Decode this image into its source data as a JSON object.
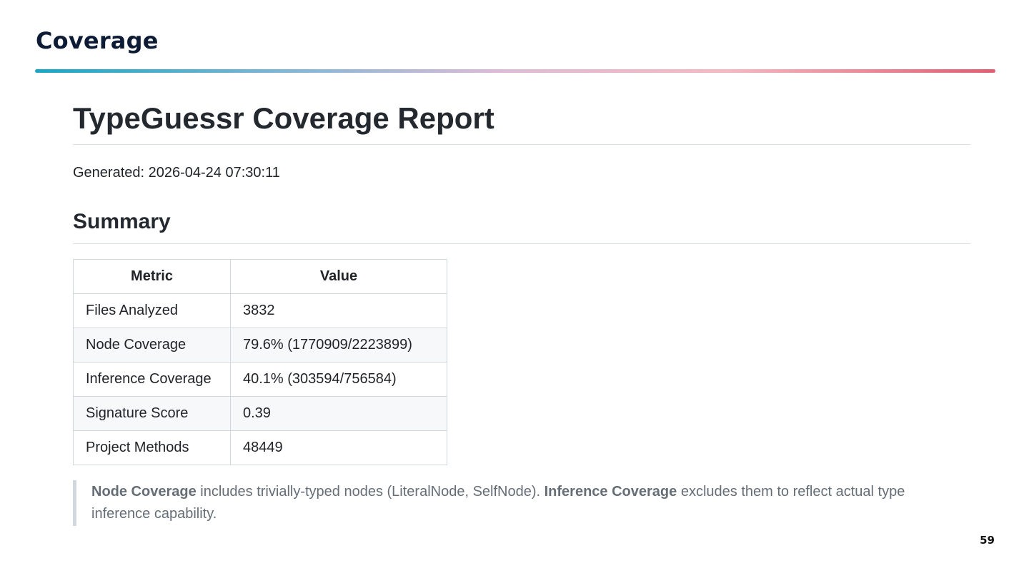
{
  "slide": {
    "title": "Coverage",
    "page_number": "59"
  },
  "report": {
    "title": "TypeGuessr Coverage Report",
    "generated": "Generated: 2026-04-24 07:30:11",
    "summary_heading": "Summary",
    "table": {
      "headers": [
        "Metric",
        "Value"
      ],
      "rows": [
        {
          "metric": "Files Analyzed",
          "value": "3832"
        },
        {
          "metric": "Node Coverage",
          "value": "79.6% (1770909/2223899)"
        },
        {
          "metric": "Inference Coverage",
          "value": "40.1% (303594/756584)"
        },
        {
          "metric": "Signature Score",
          "value": "0.39"
        },
        {
          "metric": "Project Methods",
          "value": "48449"
        }
      ]
    },
    "note": {
      "term1": "Node Coverage",
      "text1": " includes trivially-typed nodes (LiteralNode, SelfNode). ",
      "term2": "Inference Coverage",
      "text2": " excludes them to reflect actual type inference capability."
    }
  },
  "colors": {
    "title": "#0d1b35",
    "rule_start": "#17a7c4",
    "rule_end": "#e25d72",
    "note_text": "#656d76"
  }
}
